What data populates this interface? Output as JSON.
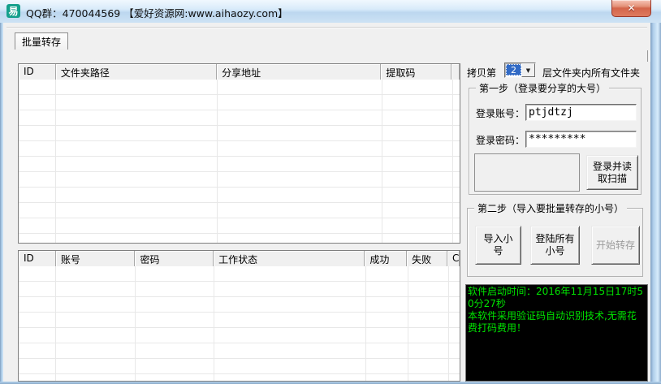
{
  "window": {
    "title": "QQ群：470044569 【爱好资源网:www.aihaozy.com】",
    "app_icon_glyph": "易",
    "close_glyph": "✕"
  },
  "tab": {
    "label": "批量转存"
  },
  "copy_row": {
    "prefix": "拷贝第",
    "selected_level": "2",
    "suffix": "层文件夹内所有文件夹"
  },
  "folders_table": {
    "columns": [
      "ID",
      "文件夹路径",
      "分享地址",
      "提取码",
      ""
    ]
  },
  "accounts_table": {
    "columns": [
      "ID",
      "账号",
      "密码",
      "工作状态",
      "成功",
      "失败",
      "C"
    ]
  },
  "step1": {
    "title": "第一步（登录要分享的大号）",
    "account_label": "登录账号：",
    "account_value": "ptjdtzj",
    "password_label": "登录密码：",
    "password_value": "*********",
    "login_button_label": "登录并读取扫描"
  },
  "step2": {
    "title": "第二步（导入要批量转存的小号）",
    "import_button_label": "导入小号",
    "login_all_button_label": "登陆所有小号",
    "start_button_label": "开始转存"
  },
  "console": {
    "lines": [
      "软件启动时间：2016年11月15日17时50分27秒",
      "本软件采用验证码自动识别技术,无需花费打码费用！"
    ]
  },
  "icons": {
    "dropdown_arrow": "▼"
  },
  "colors": {
    "console_text": "#00e400",
    "console_bg": "#000000",
    "selection_blue": "#316ac5",
    "titlebar_icon_teal": "#14a08c",
    "close_red": "#d3654a"
  }
}
